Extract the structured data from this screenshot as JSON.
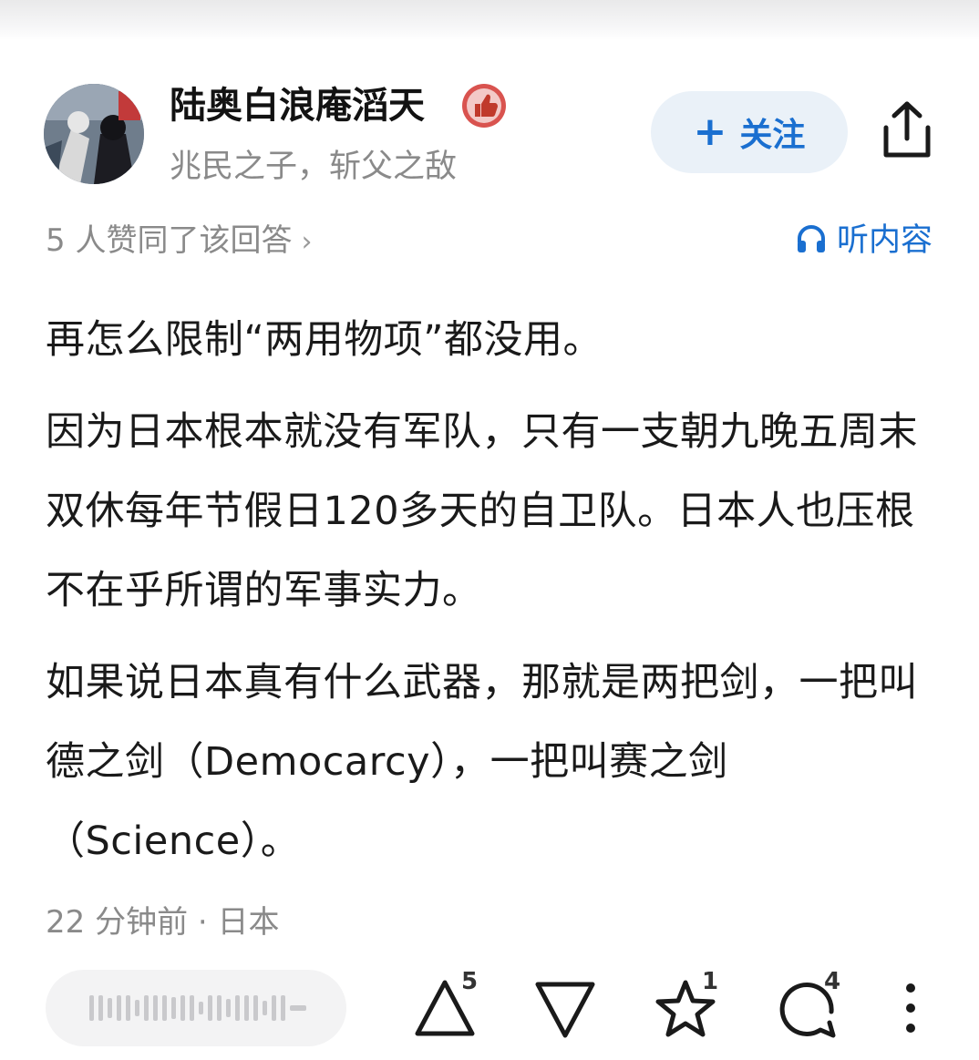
{
  "author": {
    "name": "陆奥白浪庵滔天",
    "bio": "兆民之子，斩父之敌",
    "badge_icon": "thumbs-up-badge-icon"
  },
  "header": {
    "follow_label": "关注",
    "follow_icon": "plus-icon",
    "share_icon": "share-icon"
  },
  "meta": {
    "upvote_summary": "5 人赞同了该回答",
    "chevron": "›",
    "listen_label": "听内容",
    "listen_icon": "headphones-icon"
  },
  "answer": {
    "paragraphs": [
      "再怎么限制“两用物项”都没用。",
      "因为日本根本就没有军队，只有一支朝九晚五周末双休每年节假日120多天的自卫队。日本人也压根不在乎所谓的军事实力。",
      "如果说日本真有什么武器，那就是两把剑，一把叫德之剑（Democarcy），一把叫赛之剑（Science）。"
    ],
    "time_location": "22 分钟前 · 日本"
  },
  "actions": {
    "upvote_count": "5",
    "favorite_count": "1",
    "comment_count": "4"
  },
  "colors": {
    "accent": "#1a6fd0",
    "muted": "#8a8a8a",
    "follow_bg": "#eaf1f8"
  }
}
